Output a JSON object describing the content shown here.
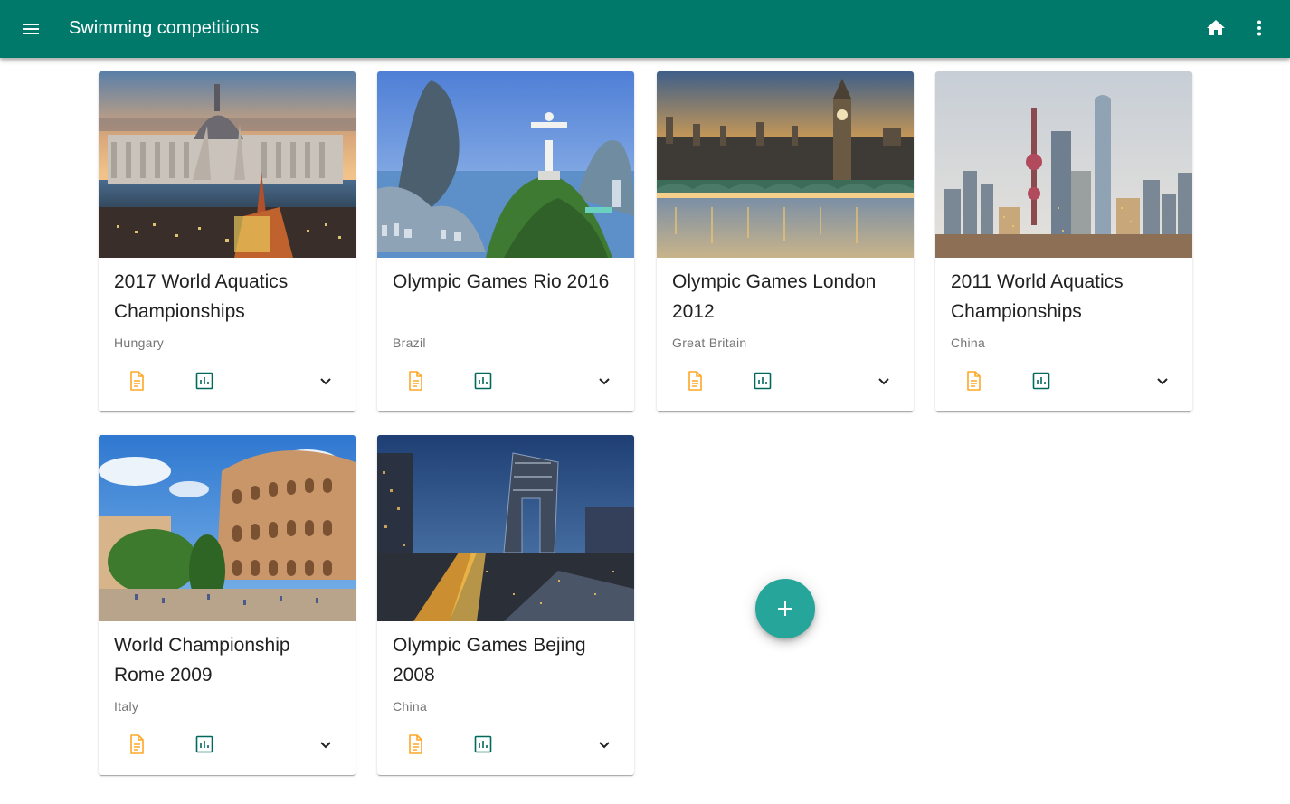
{
  "app": {
    "title": "Swimming competitions"
  },
  "icons": {
    "menu": "menu-icon",
    "home": "home-icon",
    "more": "more-vert-icon",
    "document": "description-icon",
    "stats": "bar-chart-icon",
    "expand": "expand-more-icon",
    "add": "add-icon"
  },
  "colors": {
    "appbar": "#00796b",
    "fab": "#26a69a",
    "doc_icon": "#ffa726",
    "stats_icon": "#00695c"
  },
  "cards": [
    {
      "title": "2017 World Aquatics Championships",
      "country": "Hungary",
      "image": "budapest-parliament"
    },
    {
      "title": "Olympic Games Rio 2016",
      "country": "Brazil",
      "image": "rio-christ-redeemer"
    },
    {
      "title": "Olympic Games London 2012",
      "country": "Great Britain",
      "image": "london-big-ben"
    },
    {
      "title": "2011 World Aquatics Championships",
      "country": "China",
      "image": "shanghai-skyline"
    },
    {
      "title": "World Championship Rome 2009",
      "country": "Italy",
      "image": "rome-colosseum"
    },
    {
      "title": "Olympic Games Bejing 2008",
      "country": "China",
      "image": "beijing-cctv-tower"
    }
  ]
}
